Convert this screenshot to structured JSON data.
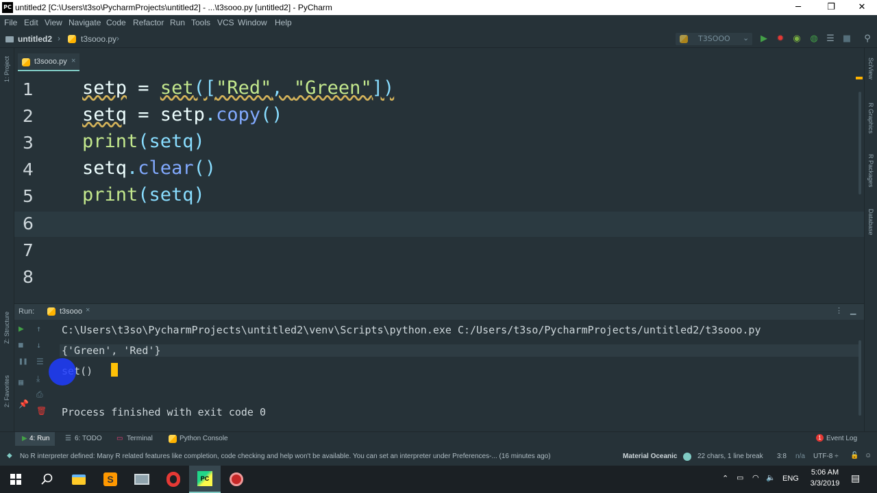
{
  "titlebar": {
    "logo": "PC",
    "title": "untitled2 [C:\\Users\\t3so\\PycharmProjects\\untitled2] - ...\\t3sooo.py [untitled2] - PyCharm",
    "minimize": "─",
    "restore": "❐",
    "close": "✕"
  },
  "menu": [
    "File",
    "Edit",
    "View",
    "Navigate",
    "Code",
    "Refactor",
    "Run",
    "Tools",
    "VCS",
    "Window",
    "Help"
  ],
  "nav": {
    "project": "untitled2",
    "file": "t3sooo.py",
    "run_config": "T3SOOO"
  },
  "left_tools": {
    "project": "1: Project",
    "structure": "Z: Structure",
    "favorites": "2: Favorites"
  },
  "right_tools": {
    "sciview": "SciView",
    "rgraphics": "R Graphics",
    "rpackages": "R Packages",
    "database": "Database"
  },
  "tab": {
    "label": "t3sooo.py"
  },
  "editor": {
    "line_numbers": [
      "1",
      "2",
      "3",
      "4",
      "5",
      "6",
      "7",
      "8"
    ],
    "lines": [
      {
        "a": "setp",
        "b": " = ",
        "c": "set",
        "d": "([",
        "e": "\"Red\"",
        "f": ", ",
        "g": "\"Green\"",
        "h": "])"
      },
      {
        "a": "setq",
        "b": " = setp",
        "c": ".",
        "d": "copy",
        "e": "()"
      },
      {
        "a": "print",
        "b": "(setq)"
      },
      {
        "a": "setq",
        "b": ".",
        "c": "clear",
        "d": "()"
      },
      {
        "a": "print",
        "b": "(setq)"
      }
    ]
  },
  "run": {
    "label": "Run:",
    "tab": "t3sooo",
    "output": [
      "C:\\Users\\t3so\\PycharmProjects\\untitled2\\venv\\Scripts\\python.exe C:/Users/t3so/PycharmProjects/untitled2/t3sooo.py",
      "{'Green', 'Red'}",
      "set()",
      "",
      "Process finished with exit code 0"
    ]
  },
  "bottom_tabs": {
    "run": "4: Run",
    "todo": "6: TODO",
    "terminal": "Terminal",
    "console": "Python Console",
    "eventlog": "Event Log"
  },
  "status": {
    "message": "No R interpreter defined: Many R related features like completion, code checking and help won't be available. You can set an interpreter under Preferences-... (16 minutes ago)",
    "theme": "Material Oceanic",
    "chars": "22 chars, 1 line break",
    "pos": "3:8",
    "na": "n/a",
    "encoding": "UTF-8 ÷"
  },
  "taskbar": {
    "lang": "ENG",
    "time": "5:06 AM",
    "date": "3/3/2019"
  },
  "colors": {
    "bg": "#263238",
    "accent": "#80cbc4",
    "string": "#c3e88d",
    "method": "#82aaff",
    "paren": "#89ddff"
  }
}
